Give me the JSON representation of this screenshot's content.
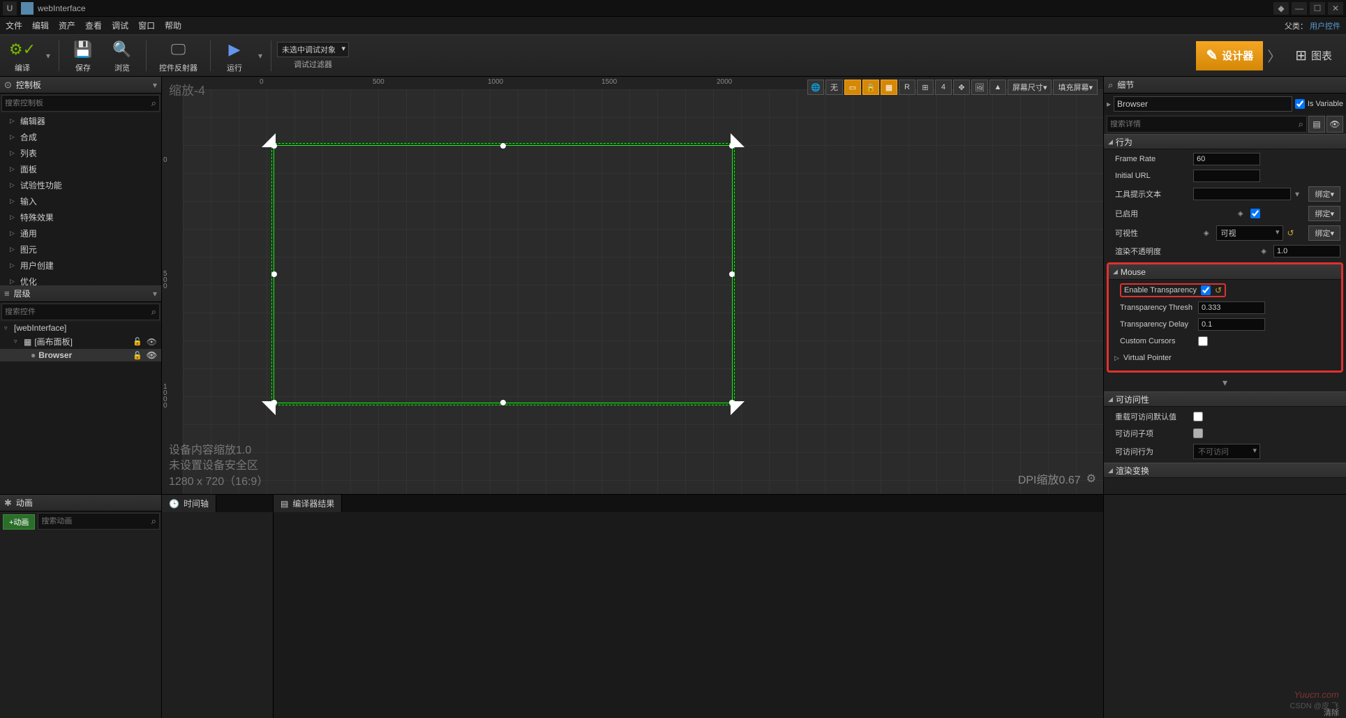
{
  "title": "webInterface",
  "menubar": {
    "items": [
      "文件",
      "编辑",
      "资产",
      "查看",
      "调试",
      "窗口",
      "帮助"
    ],
    "parent_label": "父类：",
    "parent_link": "用户控件"
  },
  "toolbar": {
    "compile": "编译",
    "save": "保存",
    "browse": "浏览",
    "reflector": "控件反射器",
    "run": "运行",
    "debug_target": "未选中调试对象",
    "debug_filter": "调试过滤器",
    "designer": "设计器",
    "graph": "图表"
  },
  "palette": {
    "header": "控制板",
    "search_placeholder": "搜索控制板",
    "items": [
      "编辑器",
      "合成",
      "列表",
      "面板",
      "试验性功能",
      "输入",
      "特殊效果",
      "通用",
      "图元",
      "用户创建",
      "优化"
    ]
  },
  "hierarchy": {
    "header": "层级",
    "search_placeholder": "搜索控件",
    "root": "[webInterface]",
    "canvas": "[画布面板]",
    "browser": "Browser"
  },
  "viewport": {
    "zoom_label": "缩放-4",
    "ruler_h": [
      "0",
      "500",
      "1000",
      "1500",
      "2000"
    ],
    "ruler_v": [
      "0",
      "500",
      "1000"
    ],
    "none_btn": "无",
    "r_btn": "R",
    "grid_val": "4",
    "screen_size": "屏幕尺寸",
    "fill_screen": "填充屏幕",
    "device_scale": "设备内容缩放1.0",
    "safe_zone": "未设置设备安全区",
    "resolution": "1280 x 720（16:9）",
    "dpi": "DPI缩放0.67"
  },
  "details": {
    "header": "细节",
    "name_value": "Browser",
    "is_variable": "Is Variable",
    "search_placeholder": "搜索详情",
    "behavior": {
      "header": "行为",
      "frame_rate_label": "Frame Rate",
      "frame_rate": "60",
      "initial_url_label": "Initial URL",
      "initial_url": "",
      "tooltip_label": "工具提示文本",
      "tooltip": "",
      "enabled_label": "已启用",
      "visibility_label": "可视性",
      "visibility": "可视",
      "opacity_label": "渲染不透明度",
      "opacity": "1.0",
      "bind": "绑定"
    },
    "mouse": {
      "header": "Mouse",
      "enable_transparency_label": "Enable Transparency",
      "threshold_label": "Transparency Thresh",
      "threshold": "0.333",
      "delay_label": "Transparency Delay",
      "delay": "0.1",
      "custom_cursors_label": "Custom Cursors",
      "virtual_pointer": "Virtual Pointer"
    },
    "accessibility": {
      "header": "可访问性",
      "override_label": "重载可访问默认值",
      "children_label": "可访问子项",
      "behavior_label": "可访问行为",
      "behavior_value": "不可访问"
    },
    "render_transform": "渲染变换"
  },
  "bottom": {
    "animation": "动画",
    "add_anim": "+动画",
    "search_anim": "搜索动画",
    "timeline": "时间轴",
    "compiler": "编译器结果",
    "clear": "清除"
  },
  "watermark": "Yuucn.com",
  "csdn": "CSDN @皮 飞"
}
